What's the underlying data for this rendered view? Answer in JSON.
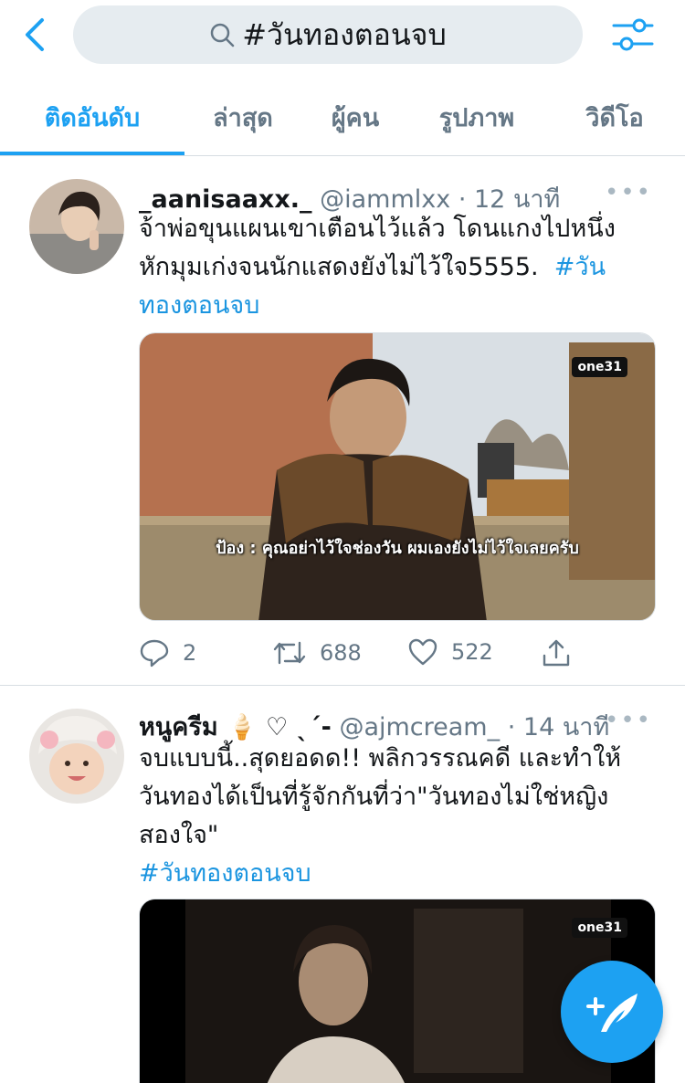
{
  "search": {
    "query": "#วันทองตอนจบ"
  },
  "tabs": [
    {
      "label": "ติดอันดับ",
      "active": true
    },
    {
      "label": "ล่าสุด"
    },
    {
      "label": "ผู้คน"
    },
    {
      "label": "รูปภาพ"
    },
    {
      "label": "วิดีโอ"
    }
  ],
  "tweets": [
    {
      "name": "_aanisaaxx._",
      "handle": "@iammlxx",
      "separator": "·",
      "time": "12 นาที",
      "more": "•••",
      "text_line1": "จ้าพ่อขุนแผนเขาเตือนไว้แล้ว โดนแกงไปหนึ่ง",
      "text_line2": "หักมุมเก่งจนนักแสดงยังไม่ไว้ใจ5555.",
      "hashtag_part1": "#วัน",
      "hashtag_part2": "ทองตอนจบ",
      "media_subtitle": "ป้อง : คุณอย่าไว้ใจช่องวัน ผมเองยังไม่ไว้ใจเลยครับ",
      "media_logo": "one31",
      "replies": "2",
      "retweets": "688",
      "likes": "522"
    },
    {
      "name": "หนูครีม 🍦 ♡ ˎˊ-",
      "handle": "@ajmcream_",
      "separator": "·",
      "time": "14 นาที",
      "more": "•••",
      "text_line1": "จบแบบนี้..สุดยอดด!! พลิกวรรณคดี และทำให้",
      "text_line2": "วันทองได้เป็นที่รู้จักกันที่ว่า\"วันทองไม่ใช่หญิง",
      "text_line3": "สองใจ\"",
      "hashtag": "#วันทองตอนจบ",
      "media_logo": "one31"
    }
  ],
  "colors": {
    "accent": "#1da1f2",
    "muted": "#657786",
    "link": "#1b95e0"
  }
}
